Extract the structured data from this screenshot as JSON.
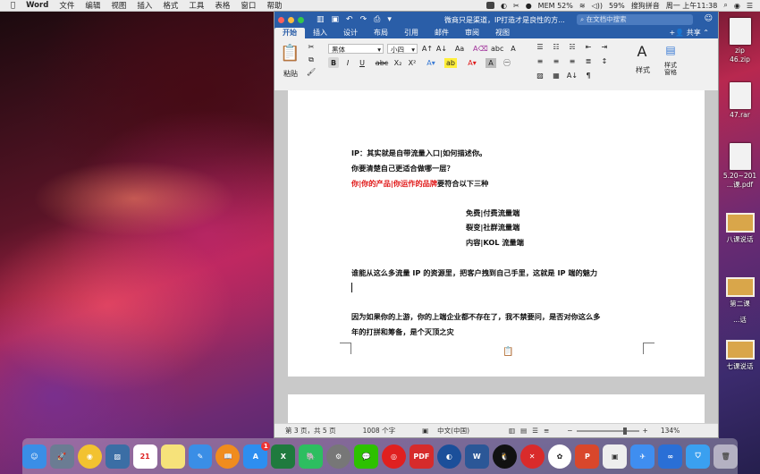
{
  "menubar": {
    "app": "Word",
    "items": [
      "文件",
      "编辑",
      "视图",
      "插入",
      "格式",
      "工具",
      "表格",
      "窗口",
      "帮助"
    ],
    "mem": "MEM 52%",
    "battery": "59%",
    "ime": "搜狗拼音",
    "clock": "周一 上午11:38"
  },
  "desktop_files": [
    {
      "label": "zip"
    },
    {
      "label": "46.zip"
    },
    {
      "label": "47.rar"
    },
    {
      "label": "5.20~201"
    },
    {
      "label": "5.20~201 ...课.pdf"
    },
    {
      "label": "八课说话"
    },
    {
      "label": "第二课"
    },
    {
      "label": "...话"
    },
    {
      "label": "七课说话"
    }
  ],
  "window": {
    "title": "微商只是渠道，IP打造才是良性的方...",
    "search_placeholder": "在文档中搜索",
    "tabs": [
      "开始",
      "插入",
      "设计",
      "布局",
      "引用",
      "邮件",
      "审阅",
      "视图"
    ],
    "share": "共享"
  },
  "ribbon": {
    "paste": "粘贴",
    "font": "黑体",
    "size": "小四",
    "styles": "样式",
    "styles_pane": "样式\n窗格"
  },
  "doc": {
    "line1": "IP：其实就是自带流量入口|如何描述你。",
    "line2": "你要清楚自己更适合做哪一层？",
    "line3_red": "你|你的产品|你运作的品牌",
    "line3_rest": "要符合以下三种",
    "center1": "免费|付费流量端",
    "center2": "裂变|社群流量端",
    "center3": "内容|KOL 流量端",
    "line4": "谁能从这么多流量 IP 的资源里，把客户拽到自己手里，这就是 IP 端的魅力",
    "line5a": "因为如果你的上游，你的上端企业都不存在了，我不禁要问，是否对你这么多",
    "line5b": "年的打拼和筹备，是个灭顶之灾"
  },
  "status": {
    "page": "第 3 页，共 5 页",
    "words": "1008 个字",
    "lang": "中文(中国)",
    "zoom": "134%"
  }
}
